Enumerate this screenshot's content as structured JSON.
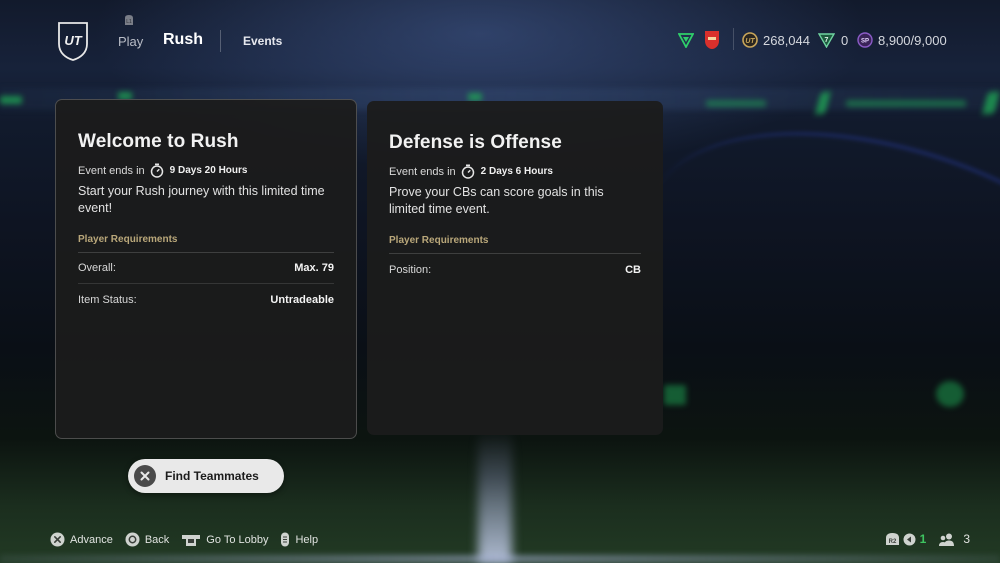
{
  "header": {
    "logo": "UT",
    "nav": {
      "play_label": "Play",
      "current_label": "Rush",
      "events_label": "Events"
    },
    "currencies": {
      "coins": "268,044",
      "fc_points": "0",
      "season_points": "8,900/9,000"
    },
    "icons": {
      "nav_hint": "controller-button-icon",
      "division": "division-badge-icon",
      "club": "club-crest-icon",
      "coins": "coins-icon",
      "points": "fc-points-icon",
      "sp": "season-points-icon"
    },
    "colors": {
      "division_green": "#2fd06a",
      "club_red": "#d9302c",
      "coin_gold": "#c9a65a",
      "sp_purple": "#8c5cc8"
    }
  },
  "events": [
    {
      "title": "Welcome to Rush",
      "ends_label": "Event ends in",
      "duration": "9 Days 20 Hours",
      "description": "Start your Rush journey with this limited time event!",
      "requirements_label": "Player Requirements",
      "requirements": [
        {
          "key": "Overall:",
          "value": "Max. 79"
        },
        {
          "key": "Item Status:",
          "value": "Untradeable"
        }
      ],
      "selected": true
    },
    {
      "title": "Defense is Offense",
      "ends_label": "Event ends in",
      "duration": "2 Days 6 Hours",
      "description": "Prove your CBs can score goals in this limited time event.",
      "requirements_label": "Player Requirements",
      "requirements": [
        {
          "key": "Position:",
          "value": "CB"
        }
      ],
      "selected": false
    }
  ],
  "find_teammates": {
    "label": "Find Teammates",
    "icon": "cross-button-icon"
  },
  "footer": {
    "hints": [
      {
        "icon": "cross-button-icon",
        "label": "Advance"
      },
      {
        "icon": "circle-button-icon",
        "label": "Back"
      },
      {
        "icon": "touchpad-icon",
        "label": "Go To Lobby"
      },
      {
        "icon": "options-button-icon",
        "label": "Help"
      }
    ],
    "status": {
      "r2_icon": "r2-button-icon",
      "voice_count": "1",
      "party_count": "3"
    }
  },
  "accent": {
    "requirements_gold": "#b9a77a",
    "card_bg": "#1c1c1c"
  }
}
